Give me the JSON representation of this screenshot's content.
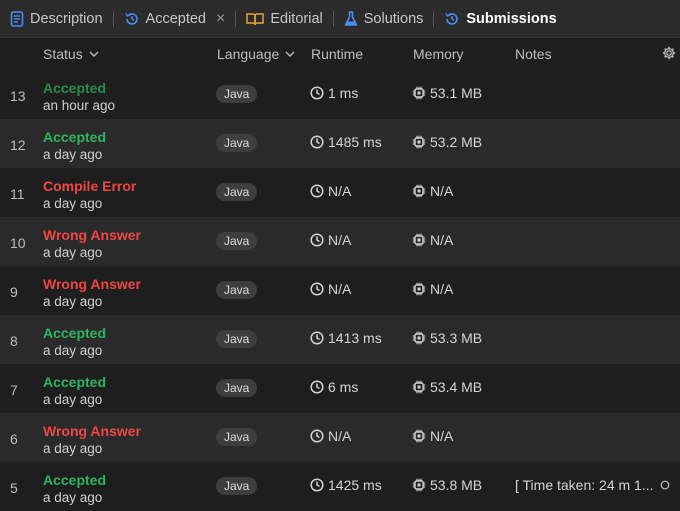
{
  "tabs": [
    {
      "label": "Description",
      "icon": "document-icon"
    },
    {
      "label": "Accepted",
      "icon": "history-icon"
    },
    {
      "label": "Editorial",
      "icon": "book-icon"
    },
    {
      "label": "Solutions",
      "icon": "flask-icon"
    },
    {
      "label": "Submissions",
      "icon": "history-icon"
    }
  ],
  "close_glyph": "×",
  "columns": {
    "status": "Status",
    "language": "Language",
    "runtime": "Runtime",
    "memory": "Memory",
    "notes": "Notes"
  },
  "rows": [
    {
      "num": "13",
      "status": "Accepted",
      "kind": "ok-dim",
      "time": "an hour ago",
      "lang": "Java",
      "runtime": "1 ms",
      "memory": "53.1 MB",
      "note": ""
    },
    {
      "num": "12",
      "status": "Accepted",
      "kind": "ok",
      "time": "a day ago",
      "lang": "Java",
      "runtime": "1485 ms",
      "memory": "53.2 MB",
      "note": ""
    },
    {
      "num": "11",
      "status": "Compile Error",
      "kind": "err",
      "time": "a day ago",
      "lang": "Java",
      "runtime": "N/A",
      "memory": "N/A",
      "note": ""
    },
    {
      "num": "10",
      "status": "Wrong Answer",
      "kind": "err",
      "time": "a day ago",
      "lang": "Java",
      "runtime": "N/A",
      "memory": "N/A",
      "note": ""
    },
    {
      "num": "9",
      "status": "Wrong Answer",
      "kind": "err",
      "time": "a day ago",
      "lang": "Java",
      "runtime": "N/A",
      "memory": "N/A",
      "note": ""
    },
    {
      "num": "8",
      "status": "Accepted",
      "kind": "ok",
      "time": "a day ago",
      "lang": "Java",
      "runtime": "1413 ms",
      "memory": "53.3 MB",
      "note": ""
    },
    {
      "num": "7",
      "status": "Accepted",
      "kind": "ok",
      "time": "a day ago",
      "lang": "Java",
      "runtime": "6 ms",
      "memory": "53.4 MB",
      "note": ""
    },
    {
      "num": "6",
      "status": "Wrong Answer",
      "kind": "err",
      "time": "a day ago",
      "lang": "Java",
      "runtime": "N/A",
      "memory": "N/A",
      "note": ""
    },
    {
      "num": "5",
      "status": "Accepted",
      "kind": "ok",
      "time": "a day ago",
      "lang": "Java",
      "runtime": "1425 ms",
      "memory": "53.8 MB",
      "note": "[ Time taken: 24 m 1..."
    }
  ],
  "colors": {
    "accepted": "#2db55d",
    "error": "#ef4743",
    "accent_blue": "#3b82f6"
  }
}
